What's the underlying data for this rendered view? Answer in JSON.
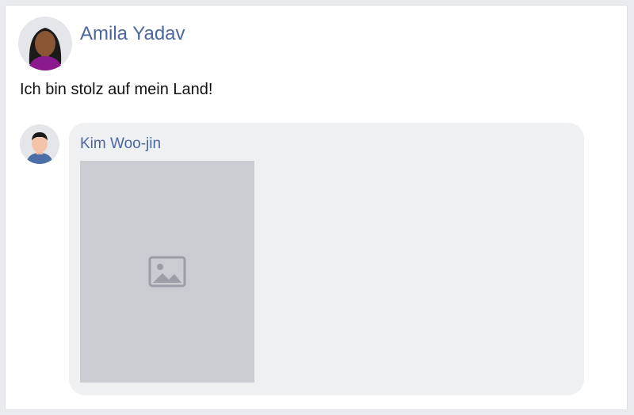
{
  "post": {
    "author": "Amila Yadav",
    "text": "Ich bin stolz auf mein Land!"
  },
  "comment": {
    "author": "Kim Woo-jin"
  },
  "colors": {
    "author_name": "#4b67a1",
    "bubble_bg": "#eff0f2",
    "page_bg": "#e9ebee"
  }
}
